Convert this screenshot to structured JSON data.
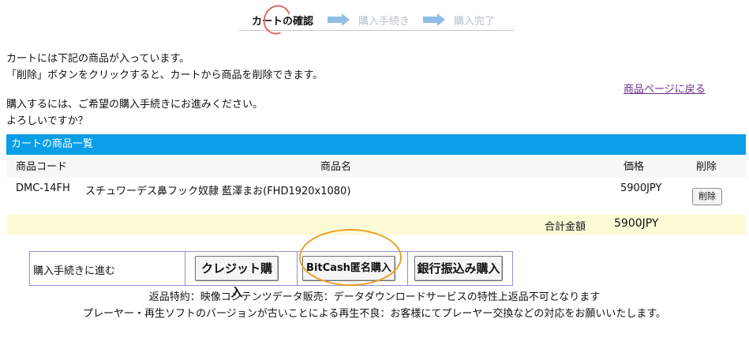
{
  "steps": {
    "step1": "カートの確認",
    "step2": "購入手続き",
    "step3": "購入完了"
  },
  "intro": {
    "line1": "カートには下記の商品が入っています。",
    "line2": "「削除」ボタンをクリックすると、カートから商品を削除できます。",
    "line3": "購入するには、ご希望の購入手続きにお進みください。",
    "line4": "よろしいですか？",
    "back_link": "商品ページに戻る"
  },
  "cart": {
    "title": "カートの商品一覧",
    "columns": {
      "code": "商品コード",
      "name": "商品名",
      "price": "価格",
      "delete": "削除"
    },
    "items": [
      {
        "code": "DMC-14FH",
        "name": "スチュワーデス鼻フック奴隷 藍澤まお(FHD1920x1080)",
        "price": "5900JPY",
        "delete_label": "削除"
      }
    ],
    "total_label": "合計金額",
    "total_value": "5900JPY"
  },
  "purchase": {
    "label": "購入手続きに進む",
    "credit_button": "クレジット購入",
    "bitcash_button": "BitCash匿名購入",
    "bank_button": "銀行振込み購入"
  },
  "notes": {
    "line1": "返品特約：映像コンテンツデータ販売：データダウンロードサービスの特性上返品不可となります",
    "line2": "プレーヤー・再生ソフトのバージョンが古いことによる再生不良：お客様にてプレーヤー交換などの対応をお願いいたします。"
  },
  "colors": {
    "cart_header": "#0a9ee6",
    "total_bg": "#fcfbd6",
    "arrow": "#8fbde6",
    "link": "#6b2e91",
    "highlight_circle": "#e9a22a"
  }
}
